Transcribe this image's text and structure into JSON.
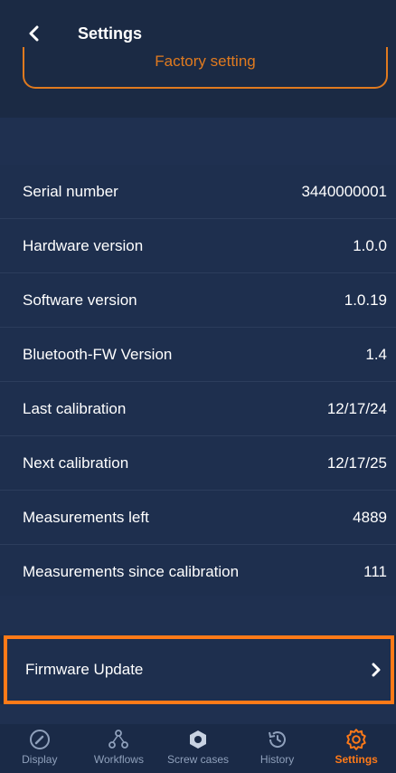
{
  "header": {
    "title": "Settings",
    "back_icon": "chevron-left-icon"
  },
  "factory_button": {
    "label": "Factory setting"
  },
  "device_info": {
    "rows": [
      {
        "label": "Serial number",
        "value": "3440000001"
      },
      {
        "label": "Hardware version",
        "value": "1.0.0"
      },
      {
        "label": "Software version",
        "value": "1.0.19"
      },
      {
        "label": "Bluetooth-FW Version",
        "value": "1.4"
      },
      {
        "label": "Last calibration",
        "value": "12/17/24"
      },
      {
        "label": "Next calibration",
        "value": "12/17/25"
      },
      {
        "label": "Measurements left",
        "value": "4889"
      },
      {
        "label": "Measurements since calibration",
        "value": "111"
      }
    ]
  },
  "firmware_update": {
    "label": "Firmware Update",
    "icon": "chevron-right-icon"
  },
  "tabs": [
    {
      "label": "Display",
      "icon": "gauge-icon",
      "active": false
    },
    {
      "label": "Workflows",
      "icon": "workflow-icon",
      "active": false
    },
    {
      "label": "Screw cases",
      "icon": "hexagon-nut-icon",
      "active": false
    },
    {
      "label": "History",
      "icon": "history-icon",
      "active": false
    },
    {
      "label": "Settings",
      "icon": "gear-icon",
      "active": true
    }
  ],
  "colors": {
    "background": "#1b2a44",
    "row_background": "#1e2f4e",
    "accent": "#ff7a18",
    "inactive_tab": "#8fa0bb"
  }
}
